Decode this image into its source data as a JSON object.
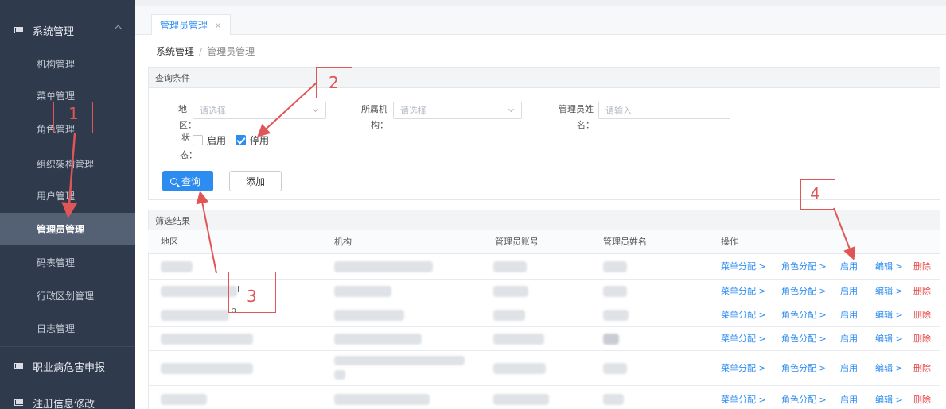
{
  "sidebar": {
    "group_system": "系统管理",
    "items": [
      {
        "label": "机构管理"
      },
      {
        "label": "菜单管理"
      },
      {
        "label": "角色管理"
      },
      {
        "label": "组织架构管理"
      },
      {
        "label": "用户管理"
      },
      {
        "label": "管理员管理"
      },
      {
        "label": "码表管理"
      },
      {
        "label": "行政区划管理"
      },
      {
        "label": "日志管理"
      }
    ],
    "active_index": 5,
    "group_occupational": "职业病危害申报",
    "group_register": "注册信息修改"
  },
  "tabs": [
    {
      "label": "管理员管理",
      "close": "×"
    }
  ],
  "breadcrumb": {
    "root": "系统管理",
    "sep": "/",
    "current": "管理员管理"
  },
  "query": {
    "header": "查询条件",
    "region_label_a": "地",
    "region_label_b": "区：",
    "region_placeholder": "请选择",
    "org_label_a": "所属机",
    "org_label_b": "构：",
    "org_placeholder": "请选择",
    "name_label_a": "管理员姓",
    "name_label_b": "名：",
    "name_placeholder": "请输入",
    "status_label_a": "状",
    "status_label_b": "态：",
    "status_options": [
      {
        "label": "启用",
        "checked": false
      },
      {
        "label": "停用",
        "checked": true
      }
    ],
    "search_button": "查询",
    "add_button": "添加"
  },
  "results": {
    "header": "筛选结果",
    "columns": [
      "地区",
      "机构",
      "管理员账号",
      "管理员姓名",
      "操作"
    ],
    "row_count": 6,
    "actions": [
      "菜单分配 >",
      "角色分配 >",
      "启用",
      "编辑 >",
      "删除"
    ],
    "cursor_marks": [
      "I",
      "b"
    ]
  },
  "annotations": [
    "1",
    "2",
    "3",
    "4"
  ],
  "colors": {
    "accent": "#2d8cf0",
    "danger": "#e4393c",
    "sidebar": "#2f3a4c",
    "annotation": "#e05555"
  }
}
